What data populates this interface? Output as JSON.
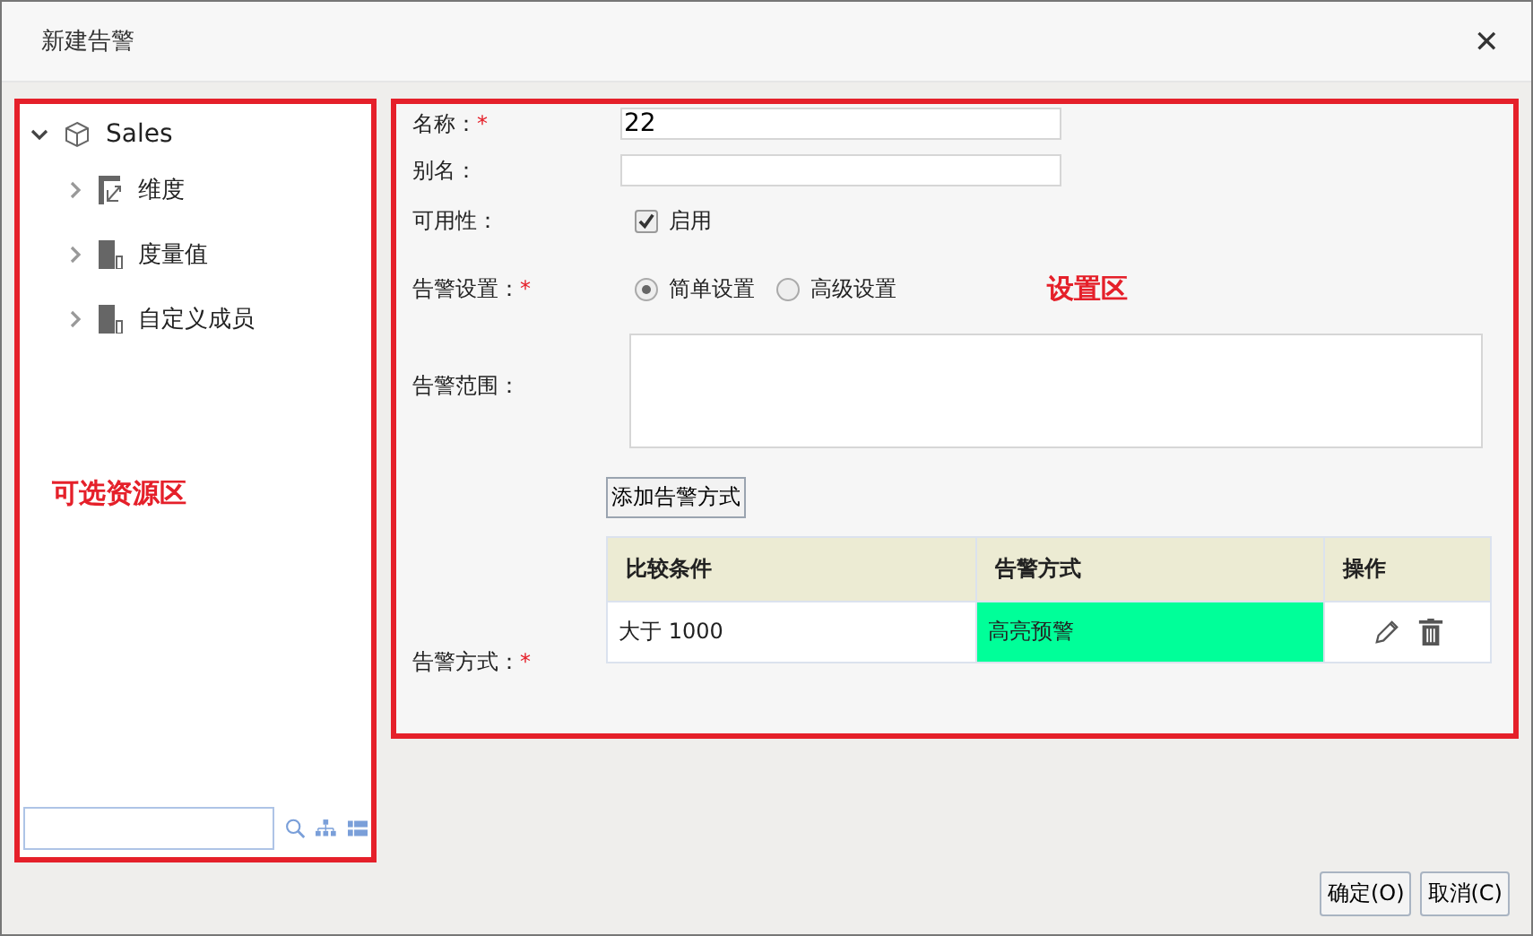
{
  "window": {
    "title": "新建告警",
    "close": "✕"
  },
  "tree": {
    "label": "Sales",
    "expanded": true,
    "children": [
      {
        "label": "维度",
        "kind": "dimension",
        "expanded": false
      },
      {
        "label": "度量值",
        "kind": "measure",
        "expanded": false
      },
      {
        "label": "自定义成员",
        "kind": "measure",
        "expanded": false
      }
    ]
  },
  "left_annotation": "可选资源区",
  "right_annotation": "设置区",
  "form": {
    "name": {
      "label": "名称：",
      "mark": "*",
      "value": "22"
    },
    "alias": {
      "label": "别名："
    },
    "availability": {
      "label": "可用性：",
      "checked": true,
      "option": "启用"
    },
    "setting": {
      "label": "告警设置：",
      "mark": "*",
      "options": [
        {
          "label": "简单设置",
          "selected": true
        },
        {
          "label": "高级设置",
          "selected": false
        }
      ]
    },
    "scope": {
      "label": "告警范围："
    },
    "add_button": "添加告警方式",
    "method_label": {
      "label": "告警方式：",
      "mark": "*"
    }
  },
  "table": {
    "columns": [
      "比较条件",
      "告警方式",
      "操作"
    ],
    "rows": [
      {
        "condition": "大于 1000",
        "method": "高亮预警",
        "color": "#00ff99"
      }
    ]
  },
  "buttons": [
    "确定(O)",
    "取消(C)"
  ]
}
